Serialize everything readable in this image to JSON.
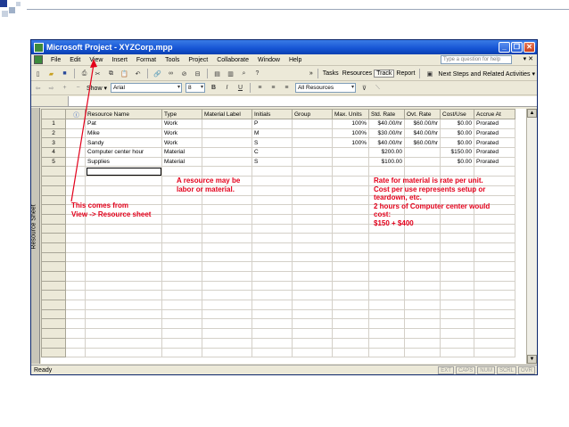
{
  "window": {
    "title": "Microsoft Project - XYZCorp.mpp",
    "help_placeholder": "Type a question for help"
  },
  "menu": {
    "items": [
      "File",
      "Edit",
      "View",
      "Insert",
      "Format",
      "Tools",
      "Project",
      "Collaborate",
      "Window",
      "Help"
    ]
  },
  "toolbar": {
    "show_label": "Show ▾",
    "font": "Arial",
    "size": "8",
    "bold": "B",
    "italic": "I",
    "underline": "U",
    "filter": "All Resources",
    "tasks": "Tasks",
    "resources": "Resources",
    "track": "Track",
    "report": "Report",
    "next_steps": "Next Steps and Related Activities ▾"
  },
  "sidebar": {
    "label": "Resource Sheet"
  },
  "table": {
    "columns": [
      "",
      "ⓘ",
      "Resource Name",
      "Type",
      "Material Label",
      "Initials",
      "Group",
      "Max. Units",
      "Std. Rate",
      "Ovt. Rate",
      "Cost/Use",
      "Accrue At"
    ],
    "rows": [
      {
        "id": "1",
        "name": "Pat",
        "type": "Work",
        "material": "",
        "initials": "P",
        "group": "",
        "max": "100%",
        "std": "$40.00/hr",
        "ovt": "$60.00/hr",
        "cost": "$0.00",
        "accrue": "Prorated"
      },
      {
        "id": "2",
        "name": "Mike",
        "type": "Work",
        "material": "",
        "initials": "M",
        "group": "",
        "max": "100%",
        "std": "$30.00/hr",
        "ovt": "$40.00/hr",
        "cost": "$0.00",
        "accrue": "Prorated"
      },
      {
        "id": "3",
        "name": "Sandy",
        "type": "Work",
        "material": "",
        "initials": "S",
        "group": "",
        "max": "100%",
        "std": "$40.00/hr",
        "ovt": "$60.00/hr",
        "cost": "$0.00",
        "accrue": "Prorated"
      },
      {
        "id": "4",
        "name": "Computer center hour",
        "type": "Material",
        "material": "",
        "initials": "C",
        "group": "",
        "max": "",
        "std": "$200.00",
        "ovt": "",
        "cost": "$150.00",
        "accrue": "Prorated"
      },
      {
        "id": "5",
        "name": "Supplies",
        "type": "Material",
        "material": "",
        "initials": "S",
        "group": "",
        "max": "",
        "std": "$100.00",
        "ovt": "",
        "cost": "$0.00",
        "accrue": "Prorated"
      }
    ]
  },
  "status": {
    "ready": "Ready",
    "indicators": [
      "EXT",
      "CAPS",
      "NUM",
      "SCRL",
      "OVR"
    ]
  },
  "annotations": {
    "labor": [
      "A resource may be",
      "labor or material."
    ],
    "view": [
      "This comes from",
      "View -> Resource sheet"
    ],
    "rate": [
      "Rate for material is rate per unit.",
      "Cost per use represents setup or",
      "teardown, etc.",
      "2 hours of Computer center would",
      "cost:",
      "$150 + $400"
    ]
  },
  "colors": {
    "annotation": "#e3001b",
    "title_bar": "#1554d4"
  }
}
